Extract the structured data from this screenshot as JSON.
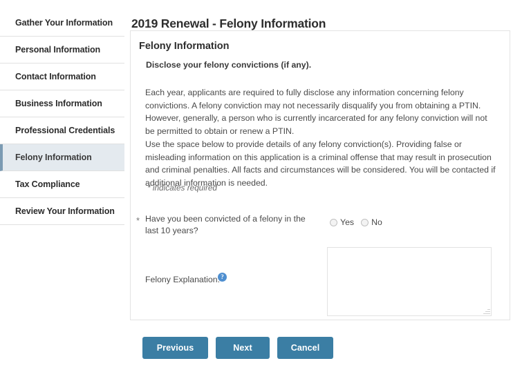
{
  "page": {
    "title": "2019 Renewal - Felony Information"
  },
  "sidebar": {
    "items": [
      {
        "label": "Gather Your Information",
        "active": false
      },
      {
        "label": "Personal Information",
        "active": false
      },
      {
        "label": "Contact Information",
        "active": false
      },
      {
        "label": "Business Information",
        "active": false
      },
      {
        "label": "Professional Credentials",
        "active": false
      },
      {
        "label": "Felony Information",
        "active": true
      },
      {
        "label": "Tax Compliance",
        "active": false
      },
      {
        "label": "Review Your Information",
        "active": false
      }
    ]
  },
  "panel": {
    "heading": "Felony Information",
    "subheading": "Disclose your felony convictions (if any).",
    "paragraph_1": "Each year, applicants are required to fully disclose any information concerning felony convictions. A felony conviction may not necessarily disqualify you from obtaining a PTIN. However, generally, a person who is currently incarcerated for any felony conviction will not be permitted to obtain or renew a PTIN.",
    "paragraph_2": "Use the space below to provide details of any felony conviction(s). Providing false or misleading information on this application is a criminal offense that may result in prosecution and criminal penalties. All facts and circumstances will be considered. You will be contacted if additional information is needed.",
    "required_note": "* indicates required"
  },
  "form": {
    "felony_question": {
      "required_marker": "*",
      "label": "Have you been convicted of a felony in the last 10 years?",
      "options": [
        {
          "label": "Yes",
          "selected": false
        },
        {
          "label": "No",
          "selected": false
        }
      ]
    },
    "explanation": {
      "label": "Felony Explanation:",
      "help_icon_glyph": "?",
      "value": "",
      "placeholder": ""
    }
  },
  "buttons": {
    "previous": "Previous",
    "next": "Next",
    "cancel": "Cancel"
  },
  "colors": {
    "button_blue": "#3b7ea4",
    "active_nav_bg": "#e4eaef",
    "active_nav_border": "#7b9bb3",
    "help_icon_blue": "#4f8fd0",
    "text_primary": "#2d2d2d",
    "text_body": "#4a4a4a"
  }
}
